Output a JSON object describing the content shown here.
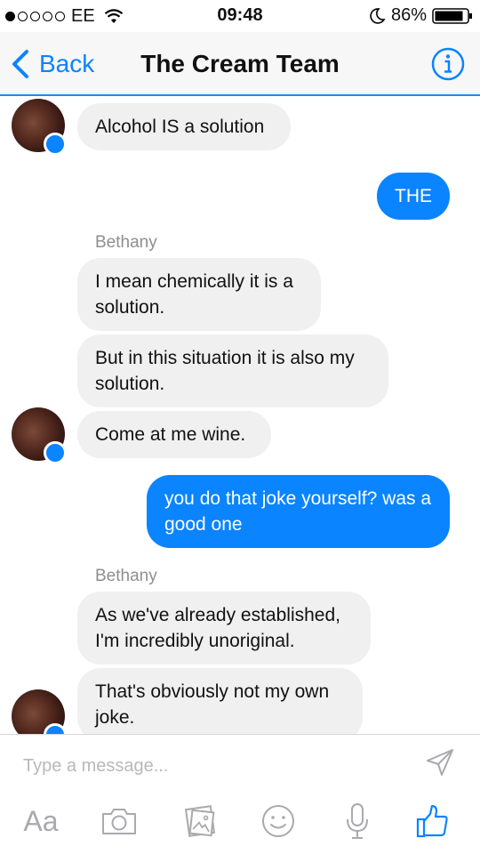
{
  "status_bar": {
    "carrier": "EE",
    "time": "09:48",
    "battery": "86%",
    "signal_dots_filled": 1,
    "signal_dots_total": 5
  },
  "nav": {
    "back_label": "Back",
    "title": "The Cream Team"
  },
  "messages": [
    {
      "direction": "incoming",
      "text": "Alcohol IS a solution"
    },
    {
      "direction": "outgoing",
      "text": "THE"
    },
    {
      "direction": "incoming",
      "sender": "Bethany",
      "text": "I mean chemically it is a solution."
    },
    {
      "direction": "incoming",
      "text": "But in this situation it is also my solution."
    },
    {
      "direction": "incoming",
      "text": "Come at me wine."
    },
    {
      "direction": "outgoing",
      "text": "you do that joke yourself? was a good one"
    },
    {
      "direction": "incoming",
      "sender": "Bethany",
      "text": "As we've already established, I'm incredibly unoriginal."
    },
    {
      "direction": "incoming",
      "text": "That's obviously not my own joke."
    }
  ],
  "composer": {
    "placeholder": "Type a message...",
    "aa_label": "Aa"
  },
  "colors": {
    "accent": "#0a84ff",
    "incoming_bubble": "#f1f0f0",
    "toolbar_icon": "#a9a9ae"
  },
  "icons": [
    "wifi-icon",
    "moon-icon",
    "battery-icon",
    "chevron-left-icon",
    "info-icon",
    "messenger-badge-icon",
    "send-icon",
    "camera-icon",
    "gallery-icon",
    "emoji-icon",
    "microphone-icon",
    "thumbs-up-icon"
  ]
}
